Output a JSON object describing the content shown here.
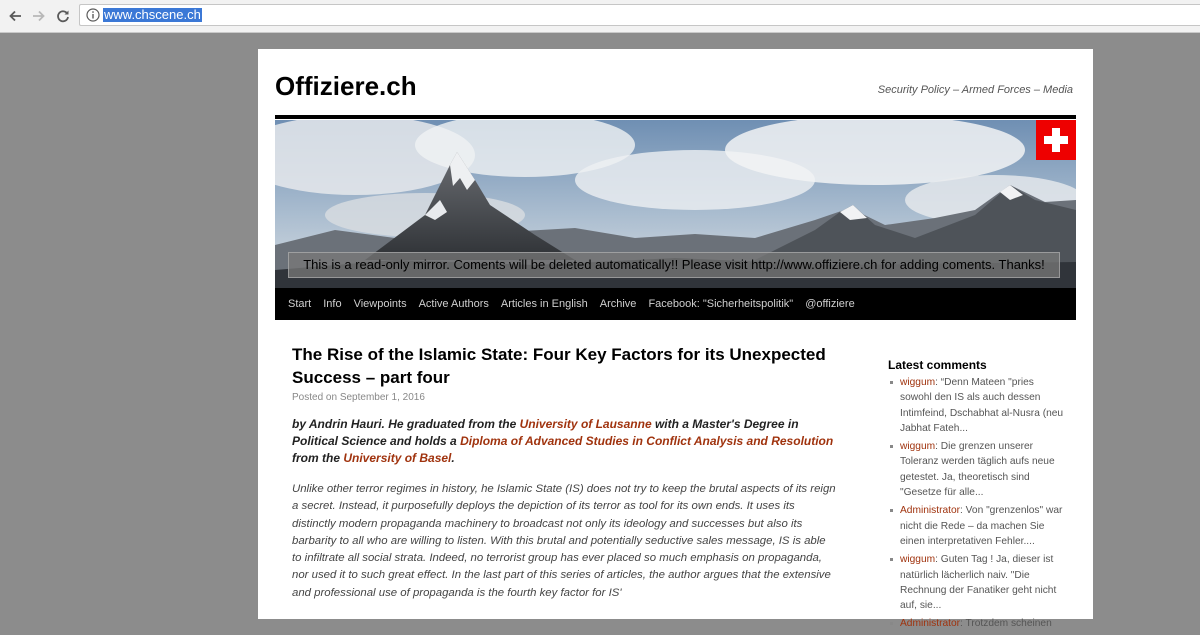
{
  "browser": {
    "url": "www.chscene.ch"
  },
  "site": {
    "title": "Offiziere.ch",
    "tagline": "Security Policy – Armed Forces – Media",
    "mirror_notice": "This is a read-only mirror. Coments will be deleted automatically!! Please visit http://www.offiziere.ch for adding coments. Thanks!"
  },
  "menu": [
    "Start",
    "Info",
    "Viewpoints",
    "Active Authors",
    "Articles in English",
    "Archive",
    "Facebook: \"Sicherheitspolitik\"",
    "@offiziere"
  ],
  "article": {
    "title": "The Rise of the Islamic State: Four Key Factors for its Unexpected Success – part four",
    "posted_label": "Posted on",
    "posted_date": "September 1, 2016",
    "intro": {
      "p1": "by Andrin Hauri. He graduated from the ",
      "link1": "University of Lausanne",
      "p2": " with a Master's Degree in Political Science and holds a ",
      "link2": "Diploma of Advanced Studies in Conflict Analysis and Resolution",
      "p3": " from the ",
      "link3": "University of Basel",
      "p4": "."
    },
    "abstract": "Unlike other terror regimes in history, he Islamic State (IS) does not try to keep the brutal aspects of its reign a secret. Instead, it purposefully deploys the depiction of its terror as tool for its own ends. It uses its distinctly modern propaganda machinery to broadcast not only its ideology and successes but also its barbarity to all who are willing to listen. With this brutal and potentially seductive sales message, IS is able to infiltrate all social strata. Indeed, no terrorist group has ever placed so much emphasis on propaganda, nor used it to such great effect. In the last part of this series of articles, the author argues that the extensive and professional use of propaganda is the fourth key factor for IS'"
  },
  "sidebar": {
    "title": "Latest comments",
    "comments": [
      {
        "author": "wiggum",
        "text": ": “Denn Mateen \"pries sowohl den IS als auch dessen Intimfeind, Dschabhat al-Nusra (neu Jabhat Fateh..."
      },
      {
        "author": "wiggum",
        "text": ": Die grenzen unserer Toleranz werden täglich aufs neue getestet. Ja, theoretisch sind \"Gesetze für alle..."
      },
      {
        "author": "Administrator",
        "text": ": Von \"grenzenlos\" war nicht die Rede – da machen Sie einen interpretativen Fehler...."
      },
      {
        "author": "wiggum",
        "text": ": Guten Tag ! Ja, dieser ist natürlich lächerlich naiv. \"Die Rechnung der Fanatiker geht nicht auf, sie..."
      },
      {
        "author": "Administrator",
        "text": ": Trotzdem scheinen"
      }
    ]
  },
  "colors": {
    "link": "#a0330e",
    "menu_bg": "#000000",
    "page_bg": "#8c8c8c",
    "url_highlight": "#3b78d6"
  }
}
